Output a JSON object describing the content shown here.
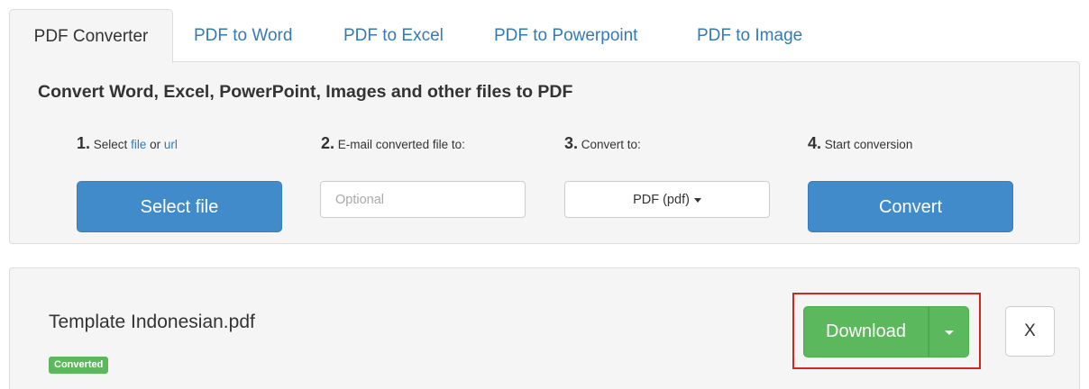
{
  "tabs": [
    {
      "label": "PDF Converter",
      "active": true
    },
    {
      "label": "PDF to Word"
    },
    {
      "label": "PDF to Excel"
    },
    {
      "label": "PDF to Powerpoint"
    },
    {
      "label": "PDF to Image"
    }
  ],
  "converter": {
    "title": "Convert Word, Excel, PowerPoint, Images and other files to PDF",
    "steps": [
      {
        "num": "1.",
        "text": "Select",
        "link_file": "file",
        "or": "or",
        "link_url": "url"
      },
      {
        "num": "2.",
        "text": "E-mail converted file to:"
      },
      {
        "num": "3.",
        "text": "Convert to:"
      },
      {
        "num": "4.",
        "text": "Start conversion"
      }
    ],
    "select_file_label": "Select file",
    "email_placeholder": "Optional",
    "format_value": "PDF (pdf)",
    "convert_label": "Convert"
  },
  "file_row": {
    "name": "Template Indonesian.pdf",
    "status": "Converted",
    "download_label": "Download",
    "close_label": "X"
  },
  "colors": {
    "primary": "#428bca",
    "success": "#5cb85c",
    "highlight": "#d0281e",
    "link": "#337ab7"
  }
}
